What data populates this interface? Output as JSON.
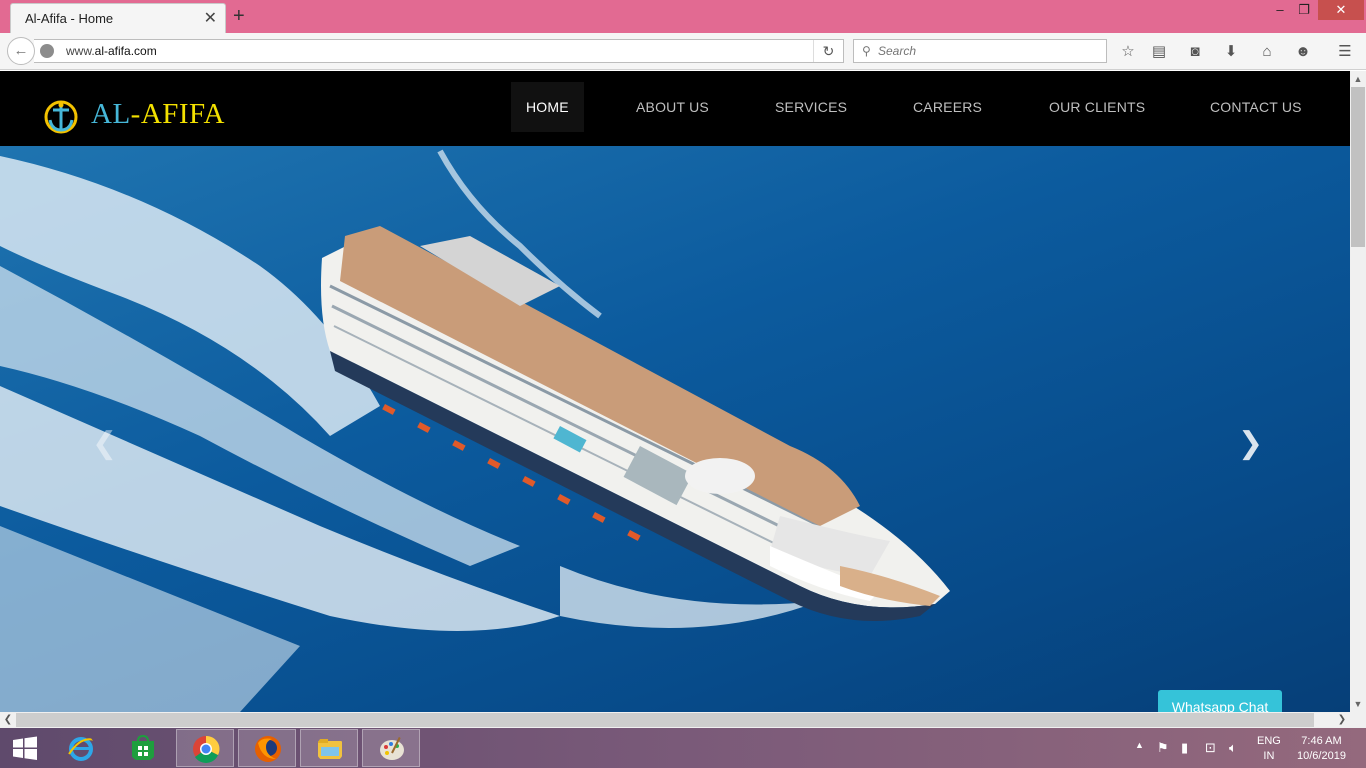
{
  "browser": {
    "tab_title": "Al-Afifa - Home",
    "url_prefix": "www.",
    "url_domain": "al-afifa.com",
    "search_placeholder": "Search"
  },
  "site": {
    "logo_part1": "AL",
    "logo_part2": "-AFIFA",
    "logo_colors": {
      "al": "#46b7d8",
      "afifa": "#f3e100"
    },
    "menu": [
      {
        "label": "HOME",
        "active": true
      },
      {
        "label": "ABOUT US"
      },
      {
        "label": "SERVICES"
      },
      {
        "label": "CAREERS"
      },
      {
        "label": "OUR CLIENTS"
      },
      {
        "label": "CONTACT US"
      }
    ],
    "hero_image": "cruise-ship-on-ocean",
    "whatsapp_label": "Whatsapp Chat",
    "whatsapp_color": "#35c3d9"
  },
  "taskbar": {
    "apps": [
      "internet-explorer-icon",
      "store-icon",
      "chrome-icon",
      "firefox-icon",
      "file-explorer-icon",
      "paint-icon"
    ],
    "lang_line1": "ENG",
    "lang_line2": "IN",
    "time": "7:46 AM",
    "date": "10/6/2019"
  }
}
